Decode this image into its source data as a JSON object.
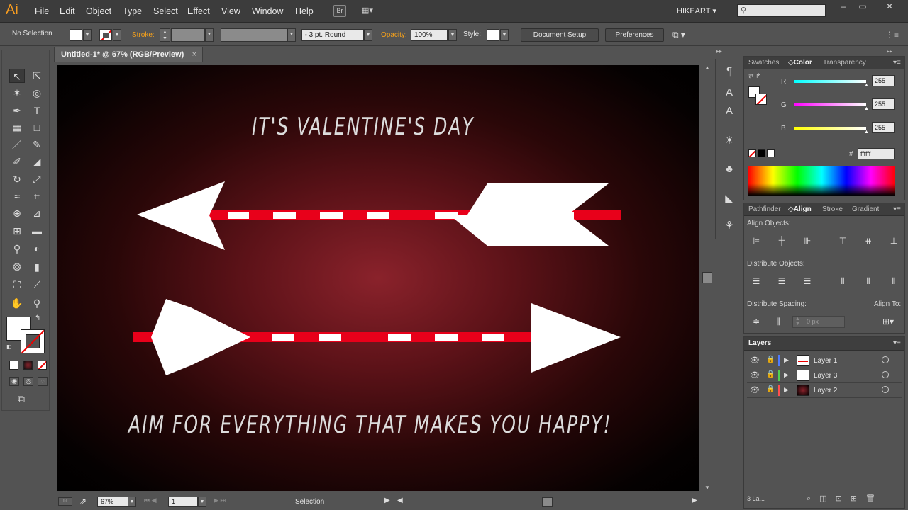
{
  "app": {
    "logo": "Ai",
    "workspace": "HIKEART"
  },
  "menu": [
    "File",
    "Edit",
    "Object",
    "Type",
    "Select",
    "Effect",
    "View",
    "Window",
    "Help"
  ],
  "bridge_label": "Br",
  "control": {
    "selection_label": "No Selection",
    "stroke_label": "Stroke:",
    "brush_value": "3 pt. Round",
    "opacity_label": "Opacity:",
    "opacity_value": "100%",
    "style_label": "Style:",
    "doc_setup": "Document Setup",
    "preferences": "Preferences"
  },
  "document": {
    "tab_title": "Untitled-1* @ 67% (RGB/Preview)"
  },
  "artwork": {
    "headline": "IT'S VALENTINE'S DAY",
    "tagline": "AIM FOR EVERYTHING THAT MAKES YOU  HAPPY!",
    "colors": {
      "bg_center": "#8a222b",
      "bg_edge": "#000000",
      "shaft_red": "#e8001a",
      "shaft_white": "#ffffff",
      "arrow_white": "#ffffff"
    }
  },
  "status": {
    "zoom": "67%",
    "page": "1",
    "tool_name": "Selection"
  },
  "color_panel": {
    "tabs": [
      "Swatches",
      "Color",
      "Transparency"
    ],
    "active_tab": "Color",
    "r_label": "R",
    "g_label": "G",
    "b_label": "B",
    "r": "255",
    "g": "255",
    "b": "255",
    "hex_label": "#",
    "hex": "ffffff"
  },
  "align_panel": {
    "tabs": [
      "Pathfinder",
      "Align",
      "Stroke",
      "Gradient"
    ],
    "active_tab": "Align",
    "align_objects": "Align Objects:",
    "distribute_objects": "Distribute Objects:",
    "distribute_spacing": "Distribute Spacing:",
    "align_to": "Align To:",
    "spacing_value": "0 px"
  },
  "layers_panel": {
    "title": "Layers",
    "layers": [
      {
        "name": "Layer 1",
        "color": "#4f7bff"
      },
      {
        "name": "Layer 3",
        "color": "#4fd14f"
      },
      {
        "name": "Layer 2",
        "color": "#ff4f4f"
      }
    ],
    "count": "3 La..."
  }
}
